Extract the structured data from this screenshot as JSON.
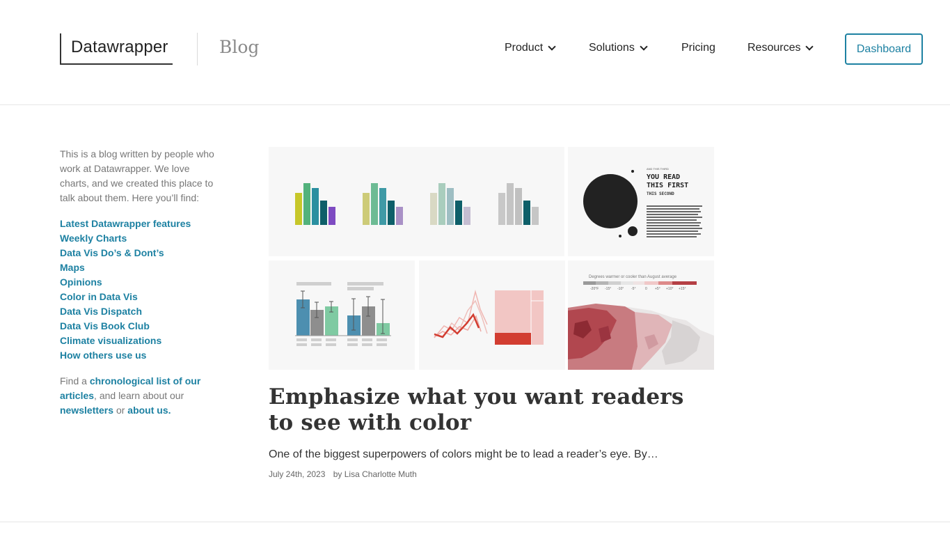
{
  "header": {
    "logo": "Datawrapper",
    "blog": "Blog",
    "nav": [
      {
        "label": "Product",
        "dropdown": true
      },
      {
        "label": "Solutions",
        "dropdown": true
      },
      {
        "label": "Pricing",
        "dropdown": false
      },
      {
        "label": "Resources",
        "dropdown": true
      }
    ],
    "dashboard": "Dashboard"
  },
  "sidebar": {
    "intro": "This is a blog written by people who work at Datawrapper. We love charts, and we created this place to talk about them. Here you’ll find:",
    "categories": [
      "Latest Datawrapper features",
      "Weekly Charts",
      "Data Vis Do’s & Dont’s",
      "Maps",
      "Opinions",
      "Color in Data Vis",
      "Data Vis Dispatch",
      "Data Vis Book Club",
      "Climate visualizations",
      "How others use us"
    ],
    "find_prefix": "Find a",
    "find_link1": "chronological list of our articles",
    "find_mid": ", and learn about our",
    "find_link2": "newsletters",
    "find_or": "or",
    "find_link3": "about us."
  },
  "hero": {
    "eyebrow": "AND THIS THIRD",
    "read_first_1": "YOU READ",
    "read_first_2": "THIS FIRST",
    "read_second": "THIS SECOND",
    "map_legend_title": "Degrees warmer or cooler than August average",
    "map_legend_ticks": [
      "-20°F",
      "-15°",
      "-10°",
      "-5°",
      "0",
      "+5°",
      "+10°",
      "+15°"
    ]
  },
  "article": {
    "title": "Emphasize what you want readers to see with color",
    "excerpt": "One of the biggest superpowers of colors might be to lead a reader’s eye. By…",
    "date": "July 24th, 2023",
    "author": "by Lisa Charlotte Muth"
  },
  "colors": {
    "accent": "#1d81a2",
    "text": "#333333",
    "muted": "#777777"
  }
}
